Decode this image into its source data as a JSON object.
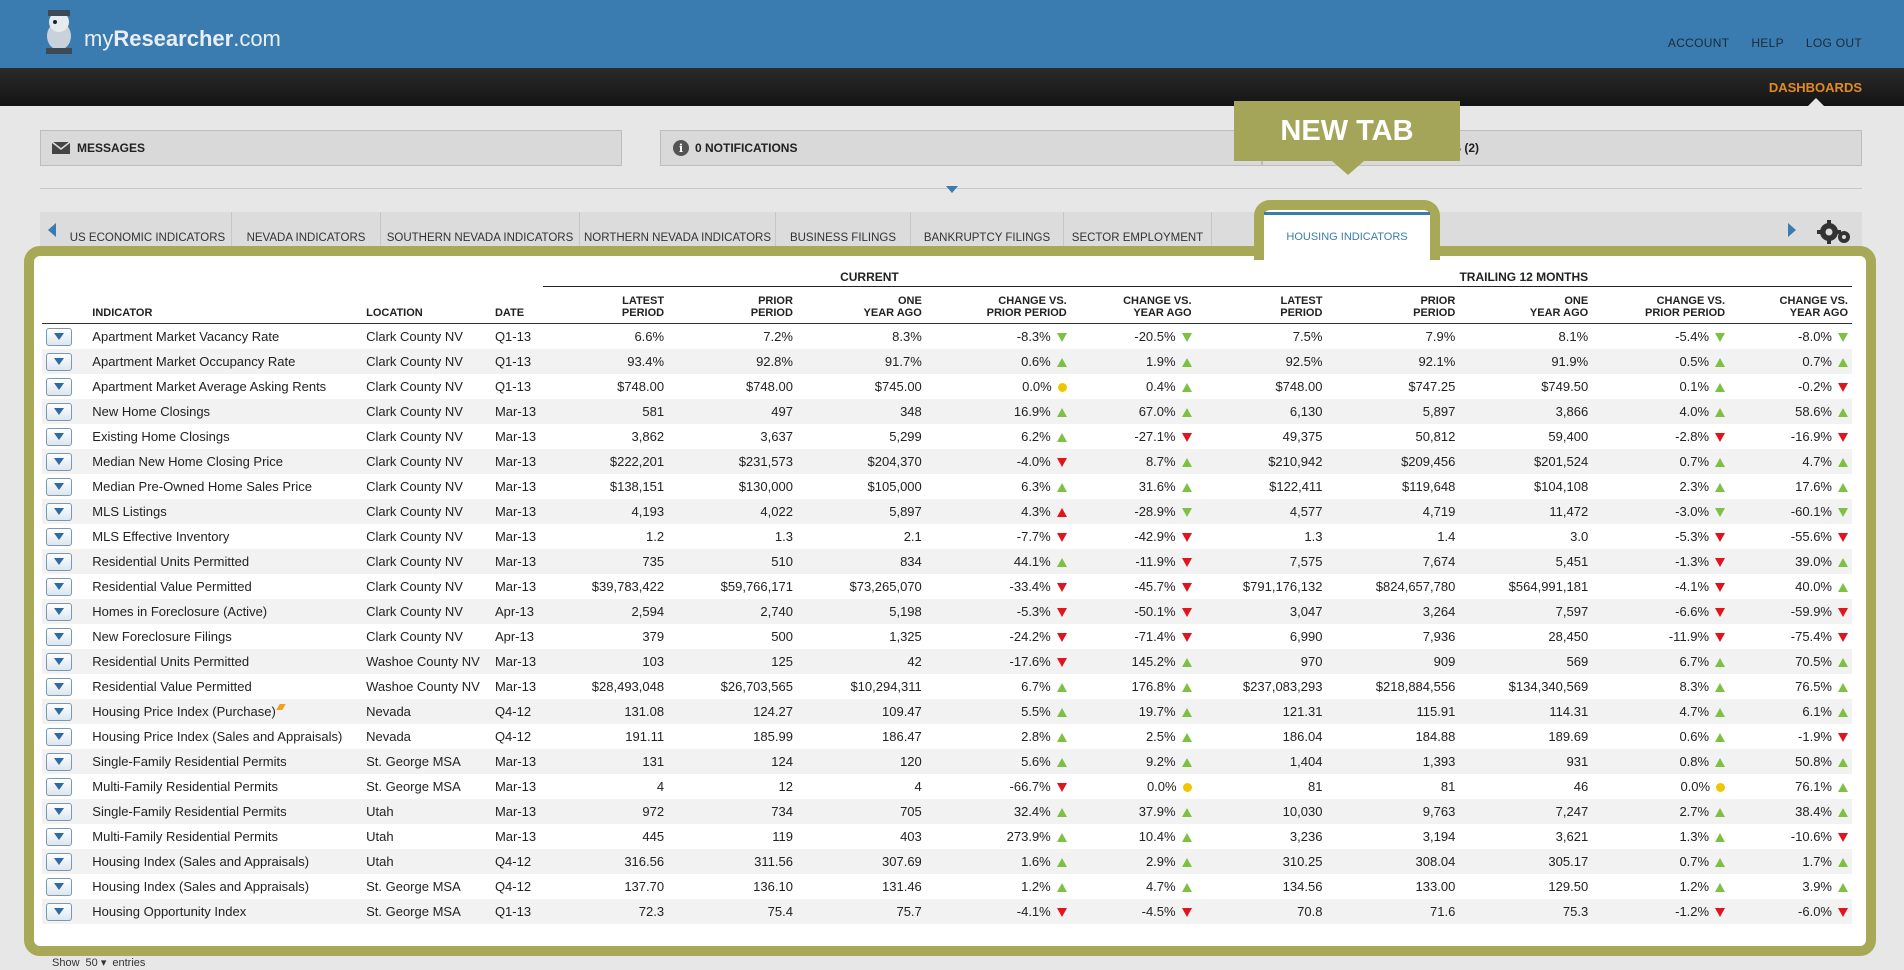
{
  "app": {
    "logo_prefix": "my",
    "logo_bold": "Researcher",
    "logo_suffix": ".com",
    "top_nav": [
      "ACCOUNT",
      "HELP",
      "LOG OUT"
    ],
    "dashboards_label": "DASHBOARDS"
  },
  "panels": {
    "messages": "MESSAGES",
    "notifications": "0 NOTIFICATIONS",
    "tasks": "S (2)"
  },
  "callout": "NEW TAB",
  "tabs": [
    "US ECONOMIC INDICATORS",
    "NEVADA INDICATORS",
    "SOUTHERN NEVADA INDICATORS",
    "NORTHERN NEVADA INDICATORS",
    "BUSINESS FILINGS",
    "BANKRUPTCY FILINGS",
    "SECTOR EMPLOYMENT"
  ],
  "active_tab": "HOUSING INDICATORS",
  "table": {
    "group_current": "CURRENT",
    "group_trailing": "TRAILING 12 MONTHS",
    "headers": {
      "indicator": "INDICATOR",
      "location": "LOCATION",
      "date": "DATE",
      "latest_1": "LATEST",
      "latest_2": "PERIOD",
      "prior_1": "PRIOR",
      "prior_2": "PERIOD",
      "one_1": "ONE",
      "one_2": "YEAR AGO",
      "chg_prior_1": "CHANGE VS.",
      "chg_prior_2": "PRIOR PERIOD",
      "chg_year_1": "CHANGE VS.",
      "chg_year_2": "YEAR AGO"
    },
    "rows": [
      {
        "indicator": "Apartment Market Vacancy Rate",
        "location": "Clark County NV",
        "date": "Q1-13",
        "c_latest": "6.6%",
        "c_prior": "7.2%",
        "c_year": "8.3%",
        "c_chg_prior": "-8.3%",
        "c_chg_prior_t": "down-green",
        "c_chg_year": "-20.5%",
        "c_chg_year_t": "down-green",
        "t_latest": "7.5%",
        "t_prior": "7.9%",
        "t_year": "8.1%",
        "t_chg_prior": "-5.4%",
        "t_chg_prior_t": "down-green",
        "t_chg_year": "-8.0%",
        "t_chg_year_t": "down-green"
      },
      {
        "indicator": "Apartment Market Occupancy Rate",
        "location": "Clark County NV",
        "date": "Q1-13",
        "c_latest": "93.4%",
        "c_prior": "92.8%",
        "c_year": "91.7%",
        "c_chg_prior": "0.6%",
        "c_chg_prior_t": "up",
        "c_chg_year": "1.9%",
        "c_chg_year_t": "up",
        "t_latest": "92.5%",
        "t_prior": "92.1%",
        "t_year": "91.9%",
        "t_chg_prior": "0.5%",
        "t_chg_prior_t": "up",
        "t_chg_year": "0.7%",
        "t_chg_year_t": "up"
      },
      {
        "indicator": "Apartment Market Average Asking Rents",
        "location": "Clark County NV",
        "date": "Q1-13",
        "c_latest": "$748.00",
        "c_prior": "$748.00",
        "c_year": "$745.00",
        "c_chg_prior": "0.0%",
        "c_chg_prior_t": "flat",
        "c_chg_year": "0.4%",
        "c_chg_year_t": "up",
        "t_latest": "$748.00",
        "t_prior": "$747.25",
        "t_year": "$749.50",
        "t_chg_prior": "0.1%",
        "t_chg_prior_t": "up",
        "t_chg_year": "-0.2%",
        "t_chg_year_t": "down-red"
      },
      {
        "indicator": "New Home Closings",
        "location": "Clark County NV",
        "date": "Mar-13",
        "c_latest": "581",
        "c_prior": "497",
        "c_year": "348",
        "c_chg_prior": "16.9%",
        "c_chg_prior_t": "up",
        "c_chg_year": "67.0%",
        "c_chg_year_t": "up",
        "t_latest": "6,130",
        "t_prior": "5,897",
        "t_year": "3,866",
        "t_chg_prior": "4.0%",
        "t_chg_prior_t": "up",
        "t_chg_year": "58.6%",
        "t_chg_year_t": "up"
      },
      {
        "indicator": "Existing Home Closings",
        "location": "Clark County NV",
        "date": "Mar-13",
        "c_latest": "3,862",
        "c_prior": "3,637",
        "c_year": "5,299",
        "c_chg_prior": "6.2%",
        "c_chg_prior_t": "up",
        "c_chg_year": "-27.1%",
        "c_chg_year_t": "down-red",
        "t_latest": "49,375",
        "t_prior": "50,812",
        "t_year": "59,400",
        "t_chg_prior": "-2.8%",
        "t_chg_prior_t": "down-red",
        "t_chg_year": "-16.9%",
        "t_chg_year_t": "down-red"
      },
      {
        "indicator": "Median New Home Closing Price",
        "location": "Clark County NV",
        "date": "Mar-13",
        "c_latest": "$222,201",
        "c_prior": "$231,573",
        "c_year": "$204,370",
        "c_chg_prior": "-4.0%",
        "c_chg_prior_t": "down-red",
        "c_chg_year": "8.7%",
        "c_chg_year_t": "up",
        "t_latest": "$210,942",
        "t_prior": "$209,456",
        "t_year": "$201,524",
        "t_chg_prior": "0.7%",
        "t_chg_prior_t": "up",
        "t_chg_year": "4.7%",
        "t_chg_year_t": "up"
      },
      {
        "indicator": "Median Pre-Owned Home Sales Price",
        "location": "Clark County NV",
        "date": "Mar-13",
        "c_latest": "$138,151",
        "c_prior": "$130,000",
        "c_year": "$105,000",
        "c_chg_prior": "6.3%",
        "c_chg_prior_t": "up",
        "c_chg_year": "31.6%",
        "c_chg_year_t": "up",
        "t_latest": "$122,411",
        "t_prior": "$119,648",
        "t_year": "$104,108",
        "t_chg_prior": "2.3%",
        "t_chg_prior_t": "up",
        "t_chg_year": "17.6%",
        "t_chg_year_t": "up"
      },
      {
        "indicator": "MLS Listings",
        "location": "Clark County NV",
        "date": "Mar-13",
        "c_latest": "4,193",
        "c_prior": "4,022",
        "c_year": "5,897",
        "c_chg_prior": "4.3%",
        "c_chg_prior_t": "up-red",
        "c_chg_year": "-28.9%",
        "c_chg_year_t": "down-green",
        "t_latest": "4,577",
        "t_prior": "4,719",
        "t_year": "11,472",
        "t_chg_prior": "-3.0%",
        "t_chg_prior_t": "down-green",
        "t_chg_year": "-60.1%",
        "t_chg_year_t": "down-green"
      },
      {
        "indicator": "MLS Effective Inventory",
        "location": "Clark County NV",
        "date": "Mar-13",
        "c_latest": "1.2",
        "c_prior": "1.3",
        "c_year": "2.1",
        "c_chg_prior": "-7.7%",
        "c_chg_prior_t": "down-red",
        "c_chg_year": "-42.9%",
        "c_chg_year_t": "down-red",
        "t_latest": "1.3",
        "t_prior": "1.4",
        "t_year": "3.0",
        "t_chg_prior": "-5.3%",
        "t_chg_prior_t": "down-red",
        "t_chg_year": "-55.6%",
        "t_chg_year_t": "down-red"
      },
      {
        "indicator": "Residential Units Permitted",
        "location": "Clark County NV",
        "date": "Mar-13",
        "c_latest": "735",
        "c_prior": "510",
        "c_year": "834",
        "c_chg_prior": "44.1%",
        "c_chg_prior_t": "up",
        "c_chg_year": "-11.9%",
        "c_chg_year_t": "down-red",
        "t_latest": "7,575",
        "t_prior": "7,674",
        "t_year": "5,451",
        "t_chg_prior": "-1.3%",
        "t_chg_prior_t": "down-red",
        "t_chg_year": "39.0%",
        "t_chg_year_t": "up"
      },
      {
        "indicator": "Residential Value Permitted",
        "location": "Clark County NV",
        "date": "Mar-13",
        "c_latest": "$39,783,422",
        "c_prior": "$59,766,171",
        "c_year": "$73,265,070",
        "c_chg_prior": "-33.4%",
        "c_chg_prior_t": "down-red",
        "c_chg_year": "-45.7%",
        "c_chg_year_t": "down-red",
        "t_latest": "$791,176,132",
        "t_prior": "$824,657,780",
        "t_year": "$564,991,181",
        "t_chg_prior": "-4.1%",
        "t_chg_prior_t": "down-red",
        "t_chg_year": "40.0%",
        "t_chg_year_t": "up"
      },
      {
        "indicator": "Homes in Foreclosure (Active)",
        "location": "Clark County NV",
        "date": "Apr-13",
        "c_latest": "2,594",
        "c_prior": "2,740",
        "c_year": "5,198",
        "c_chg_prior": "-5.3%",
        "c_chg_prior_t": "down-red",
        "c_chg_year": "-50.1%",
        "c_chg_year_t": "down-red",
        "t_latest": "3,047",
        "t_prior": "3,264",
        "t_year": "7,597",
        "t_chg_prior": "-6.6%",
        "t_chg_prior_t": "down-red",
        "t_chg_year": "-59.9%",
        "t_chg_year_t": "down-red"
      },
      {
        "indicator": "New Foreclosure Filings",
        "location": "Clark County NV",
        "date": "Apr-13",
        "c_latest": "379",
        "c_prior": "500",
        "c_year": "1,325",
        "c_chg_prior": "-24.2%",
        "c_chg_prior_t": "down-red",
        "c_chg_year": "-71.4%",
        "c_chg_year_t": "down-red",
        "t_latest": "6,990",
        "t_prior": "7,936",
        "t_year": "28,450",
        "t_chg_prior": "-11.9%",
        "t_chg_prior_t": "down-red",
        "t_chg_year": "-75.4%",
        "t_chg_year_t": "down-red"
      },
      {
        "indicator": "Residential Units Permitted",
        "location": "Washoe County NV",
        "date": "Mar-13",
        "c_latest": "103",
        "c_prior": "125",
        "c_year": "42",
        "c_chg_prior": "-17.6%",
        "c_chg_prior_t": "down-red",
        "c_chg_year": "145.2%",
        "c_chg_year_t": "up",
        "t_latest": "970",
        "t_prior": "909",
        "t_year": "569",
        "t_chg_prior": "6.7%",
        "t_chg_prior_t": "up",
        "t_chg_year": "70.5%",
        "t_chg_year_t": "up"
      },
      {
        "indicator": "Residential Value Permitted",
        "location": "Washoe County NV",
        "date": "Mar-13",
        "c_latest": "$28,493,048",
        "c_prior": "$26,703,565",
        "c_year": "$10,294,311",
        "c_chg_prior": "6.7%",
        "c_chg_prior_t": "up",
        "c_chg_year": "176.8%",
        "c_chg_year_t": "up",
        "t_latest": "$237,083,293",
        "t_prior": "$218,884,556",
        "t_year": "$134,340,569",
        "t_chg_prior": "8.3%",
        "t_chg_prior_t": "up",
        "t_chg_year": "76.5%",
        "t_chg_year_t": "up"
      },
      {
        "indicator": "Housing Price Index (Purchase)",
        "location": "Nevada",
        "date": "Q4-12",
        "c_latest": "131.08",
        "c_prior": "124.27",
        "c_year": "109.47",
        "c_chg_prior": "5.5%",
        "c_chg_prior_t": "up",
        "c_chg_year": "19.7%",
        "c_chg_year_t": "up",
        "t_latest": "121.31",
        "t_prior": "115.91",
        "t_year": "114.31",
        "t_chg_prior": "4.7%",
        "t_chg_prior_t": "up",
        "t_chg_year": "6.1%",
        "t_chg_year_t": "up",
        "flag": true
      },
      {
        "indicator": "Housing Price Index (Sales and Appraisals)",
        "location": "Nevada",
        "date": "Q4-12",
        "c_latest": "191.11",
        "c_prior": "185.99",
        "c_year": "186.47",
        "c_chg_prior": "2.8%",
        "c_chg_prior_t": "up",
        "c_chg_year": "2.5%",
        "c_chg_year_t": "up",
        "t_latest": "186.04",
        "t_prior": "184.88",
        "t_year": "189.69",
        "t_chg_prior": "0.6%",
        "t_chg_prior_t": "up",
        "t_chg_year": "-1.9%",
        "t_chg_year_t": "down-red"
      },
      {
        "indicator": "Single-Family Residential Permits",
        "location": "St. George MSA",
        "date": "Mar-13",
        "c_latest": "131",
        "c_prior": "124",
        "c_year": "120",
        "c_chg_prior": "5.6%",
        "c_chg_prior_t": "up",
        "c_chg_year": "9.2%",
        "c_chg_year_t": "up",
        "t_latest": "1,404",
        "t_prior": "1,393",
        "t_year": "931",
        "t_chg_prior": "0.8%",
        "t_chg_prior_t": "up",
        "t_chg_year": "50.8%",
        "t_chg_year_t": "up"
      },
      {
        "indicator": "Multi-Family Residential Permits",
        "location": "St. George MSA",
        "date": "Mar-13",
        "c_latest": "4",
        "c_prior": "12",
        "c_year": "4",
        "c_chg_prior": "-66.7%",
        "c_chg_prior_t": "down-red",
        "c_chg_year": "0.0%",
        "c_chg_year_t": "flat",
        "t_latest": "81",
        "t_prior": "81",
        "t_year": "46",
        "t_chg_prior": "0.0%",
        "t_chg_prior_t": "flat",
        "t_chg_year": "76.1%",
        "t_chg_year_t": "up"
      },
      {
        "indicator": "Single-Family Residential Permits",
        "location": "Utah",
        "date": "Mar-13",
        "c_latest": "972",
        "c_prior": "734",
        "c_year": "705",
        "c_chg_prior": "32.4%",
        "c_chg_prior_t": "up",
        "c_chg_year": "37.9%",
        "c_chg_year_t": "up",
        "t_latest": "10,030",
        "t_prior": "9,763",
        "t_year": "7,247",
        "t_chg_prior": "2.7%",
        "t_chg_prior_t": "up",
        "t_chg_year": "38.4%",
        "t_chg_year_t": "up"
      },
      {
        "indicator": "Multi-Family Residential Permits",
        "location": "Utah",
        "date": "Mar-13",
        "c_latest": "445",
        "c_prior": "119",
        "c_year": "403",
        "c_chg_prior": "273.9%",
        "c_chg_prior_t": "up",
        "c_chg_year": "10.4%",
        "c_chg_year_t": "up",
        "t_latest": "3,236",
        "t_prior": "3,194",
        "t_year": "3,621",
        "t_chg_prior": "1.3%",
        "t_chg_prior_t": "up",
        "t_chg_year": "-10.6%",
        "t_chg_year_t": "down-red"
      },
      {
        "indicator": "Housing Index (Sales and Appraisals)",
        "location": "Utah",
        "date": "Q4-12",
        "c_latest": "316.56",
        "c_prior": "311.56",
        "c_year": "307.69",
        "c_chg_prior": "1.6%",
        "c_chg_prior_t": "up",
        "c_chg_year": "2.9%",
        "c_chg_year_t": "up",
        "t_latest": "310.25",
        "t_prior": "308.04",
        "t_year": "305.17",
        "t_chg_prior": "0.7%",
        "t_chg_prior_t": "up",
        "t_chg_year": "1.7%",
        "t_chg_year_t": "up"
      },
      {
        "indicator": "Housing Index (Sales and Appraisals)",
        "location": "St. George MSA",
        "date": "Q4-12",
        "c_latest": "137.70",
        "c_prior": "136.10",
        "c_year": "131.46",
        "c_chg_prior": "1.2%",
        "c_chg_prior_t": "up",
        "c_chg_year": "4.7%",
        "c_chg_year_t": "up",
        "t_latest": "134.56",
        "t_prior": "133.00",
        "t_year": "129.50",
        "t_chg_prior": "1.2%",
        "t_chg_prior_t": "up",
        "t_chg_year": "3.9%",
        "t_chg_year_t": "up"
      },
      {
        "indicator": "Housing Opportunity Index",
        "location": "St. George MSA",
        "date": "Q1-13",
        "c_latest": "72.3",
        "c_prior": "75.4",
        "c_year": "75.7",
        "c_chg_prior": "-4.1%",
        "c_chg_prior_t": "down-red",
        "c_chg_year": "-4.5%",
        "c_chg_year_t": "down-red",
        "t_latest": "70.8",
        "t_prior": "71.6",
        "t_year": "75.3",
        "t_chg_prior": "-1.2%",
        "t_chg_prior_t": "down-red",
        "t_chg_year": "-6.0%",
        "t_chg_year_t": "down-red"
      }
    ]
  },
  "footer": {
    "show": "Show",
    "page_size": "50",
    "entries": "entries"
  },
  "colors": {
    "brand_blue": "#3a7bb0",
    "highlight": "#a7a956",
    "up": "#7dc142",
    "down": "#e0141c",
    "flat": "#f2c500",
    "accent_orange": "#e38a22"
  }
}
